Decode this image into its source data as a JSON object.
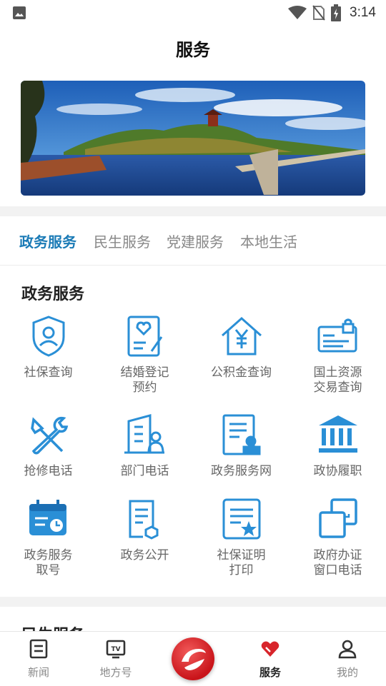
{
  "status_bar": {
    "time": "3:14"
  },
  "page_title": "服务",
  "tabs": [
    {
      "label": "政务服务",
      "active": true
    },
    {
      "label": "民生服务",
      "active": false
    },
    {
      "label": "党建服务",
      "active": false
    },
    {
      "label": "本地生活",
      "active": false
    }
  ],
  "section": {
    "title": "政务服务",
    "items": [
      {
        "label": "社保查询",
        "icon": "shield-user-icon"
      },
      {
        "label": "结婚登记\n预约",
        "icon": "heart-document-icon"
      },
      {
        "label": "公积金查询",
        "icon": "house-yuan-icon"
      },
      {
        "label": "国土资源\n交易查询",
        "icon": "id-card-lock-icon"
      },
      {
        "label": "抢修电话",
        "icon": "wrench-screwdriver-icon"
      },
      {
        "label": "部门电话",
        "icon": "building-person-icon"
      },
      {
        "label": "政务服务网",
        "icon": "document-stamp-icon"
      },
      {
        "label": "政协履职",
        "icon": "institution-icon"
      },
      {
        "label": "政务服务\n取号",
        "icon": "calendar-clock-icon"
      },
      {
        "label": "政务公开",
        "icon": "document-gear-icon"
      },
      {
        "label": "社保证明\n打印",
        "icon": "certificate-star-icon"
      },
      {
        "label": "政府办证\n窗口电话",
        "icon": "copy-squares-icon"
      }
    ]
  },
  "next_section": {
    "title": "民生服务"
  },
  "bottom_nav": [
    {
      "label": "新闻",
      "icon": "news-icon",
      "active": false
    },
    {
      "label": "地方号",
      "icon": "tv-icon",
      "active": false
    },
    {
      "label": "",
      "icon": "center-logo-icon",
      "active": false
    },
    {
      "label": "服务",
      "icon": "heart-service-icon",
      "active": true
    },
    {
      "label": "我的",
      "icon": "person-icon",
      "active": false
    }
  ],
  "colors": {
    "accent": "#1b7bb6",
    "icon_blue": "#2a8fd6",
    "nav_red": "#d8252b"
  }
}
